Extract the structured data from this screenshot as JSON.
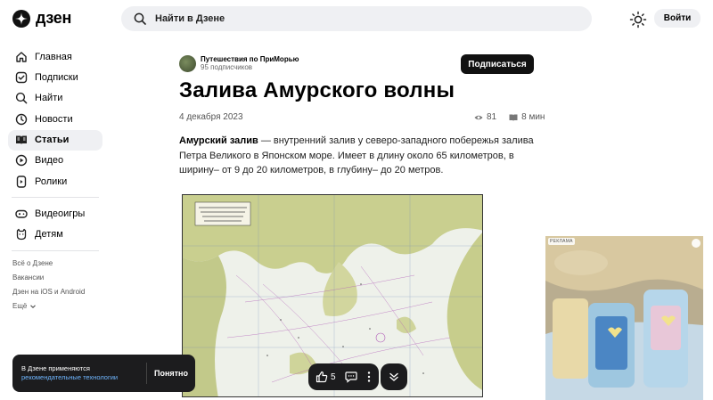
{
  "header": {
    "logo_text": "дзен",
    "search_placeholder": "Найти в Дзене",
    "login_label": "Войти"
  },
  "sidebar": {
    "primary": [
      {
        "label": "Главная",
        "icon": "home-icon"
      },
      {
        "label": "Подписки",
        "icon": "subscriptions-icon"
      },
      {
        "label": "Найти",
        "icon": "search-icon"
      },
      {
        "label": "Новости",
        "icon": "news-icon"
      },
      {
        "label": "Статьи",
        "icon": "articles-icon",
        "active": true
      },
      {
        "label": "Видео",
        "icon": "video-icon"
      },
      {
        "label": "Ролики",
        "icon": "shorts-icon"
      }
    ],
    "secondary": [
      {
        "label": "Видеоигры",
        "icon": "gamepad-icon"
      },
      {
        "label": "Детям",
        "icon": "kids-icon"
      }
    ],
    "footer": {
      "about": "Всё о Дзене",
      "jobs": "Вакансии",
      "apps": "Дзен на iOS и Android",
      "more": "Ещё"
    }
  },
  "article": {
    "channel_name": "Путешествия по ПриМорью",
    "channel_subscribers": "95 подписчиков",
    "subscribe_label": "Подписаться",
    "title": "Залива Амурского волны",
    "date": "4 декабря 2023",
    "views": "81",
    "read_time": "8 мин",
    "lead_bold": "Амурский залив",
    "lead_text": " — внутренний залив у северо-западного побережья залива Петра Великого в Японском море. Имеет в длину около 65 километров, в ширину– от 9 до 20 километров, в глубину– до 20 метров."
  },
  "floating_bar": {
    "likes": "5"
  },
  "cookie": {
    "text": "В Дзене применяются",
    "link": "рекомендательные технологии",
    "button": "Понятно"
  },
  "ad": {
    "label": "РЕКЛАМА"
  }
}
